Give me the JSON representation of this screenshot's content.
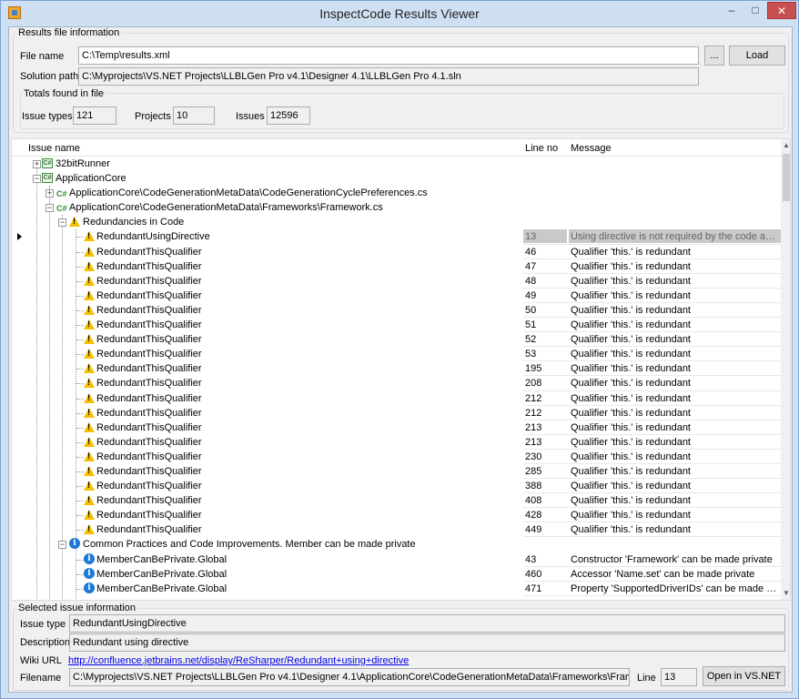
{
  "window": {
    "title": "InspectCode Results Viewer",
    "controls": {
      "min": "–",
      "max": "□",
      "close": "✕"
    }
  },
  "results_group": {
    "label": "Results file information",
    "file_name_label": "File name",
    "file_name_value": "C:\\Temp\\results.xml",
    "browse_label": "...",
    "load_label": "Load",
    "solution_path_label": "Solution path",
    "solution_path_value": "C:\\Myprojects\\VS.NET Projects\\LLBLGen Pro v4.1\\Designer 4.1\\LLBLGen Pro 4.1.sln"
  },
  "totals_group": {
    "label": "Totals found in file",
    "issue_types_label": "Issue types",
    "issue_types_value": "121",
    "projects_label": "Projects",
    "projects_value": "10",
    "issues_label": "Issues",
    "issues_value": "12596"
  },
  "grid": {
    "columns": {
      "name": "Issue name",
      "line": "Line no",
      "message": "Message"
    },
    "tree": {
      "project1": "32bitRunner",
      "project2": "ApplicationCore",
      "file1": "ApplicationCore\\CodeGenerationMetaData\\CodeGenerationCyclePreferences.cs",
      "file2": "ApplicationCore\\CodeGenerationMetaData\\Frameworks\\Framework.cs",
      "category1": "Redundancies in Code",
      "category2": "Common Practices and Code Improvements. Member can be made private"
    },
    "redundancy_rows": [
      {
        "name": "RedundantUsingDirective",
        "line": "13",
        "message": "Using directive is not required by the code and can b..."
      },
      {
        "name": "RedundantThisQualifier",
        "line": "46",
        "message": "Qualifier 'this.' is redundant"
      },
      {
        "name": "RedundantThisQualifier",
        "line": "47",
        "message": "Qualifier 'this.' is redundant"
      },
      {
        "name": "RedundantThisQualifier",
        "line": "48",
        "message": "Qualifier 'this.' is redundant"
      },
      {
        "name": "RedundantThisQualifier",
        "line": "49",
        "message": "Qualifier 'this.' is redundant"
      },
      {
        "name": "RedundantThisQualifier",
        "line": "50",
        "message": "Qualifier 'this.' is redundant"
      },
      {
        "name": "RedundantThisQualifier",
        "line": "51",
        "message": "Qualifier 'this.' is redundant"
      },
      {
        "name": "RedundantThisQualifier",
        "line": "52",
        "message": "Qualifier 'this.' is redundant"
      },
      {
        "name": "RedundantThisQualifier",
        "line": "53",
        "message": "Qualifier 'this.' is redundant"
      },
      {
        "name": "RedundantThisQualifier",
        "line": "195",
        "message": "Qualifier 'this.' is redundant"
      },
      {
        "name": "RedundantThisQualifier",
        "line": "208",
        "message": "Qualifier 'this.' is redundant"
      },
      {
        "name": "RedundantThisQualifier",
        "line": "212",
        "message": "Qualifier 'this.' is redundant"
      },
      {
        "name": "RedundantThisQualifier",
        "line": "212",
        "message": "Qualifier 'this.' is redundant"
      },
      {
        "name": "RedundantThisQualifier",
        "line": "213",
        "message": "Qualifier 'this.' is redundant"
      },
      {
        "name": "RedundantThisQualifier",
        "line": "213",
        "message": "Qualifier 'this.' is redundant"
      },
      {
        "name": "RedundantThisQualifier",
        "line": "230",
        "message": "Qualifier 'this.' is redundant"
      },
      {
        "name": "RedundantThisQualifier",
        "line": "285",
        "message": "Qualifier 'this.' is redundant"
      },
      {
        "name": "RedundantThisQualifier",
        "line": "388",
        "message": "Qualifier 'this.' is redundant"
      },
      {
        "name": "RedundantThisQualifier",
        "line": "408",
        "message": "Qualifier 'this.' is redundant"
      },
      {
        "name": "RedundantThisQualifier",
        "line": "428",
        "message": "Qualifier 'this.' is redundant"
      },
      {
        "name": "RedundantThisQualifier",
        "line": "449",
        "message": "Qualifier 'this.' is redundant"
      }
    ],
    "private_rows": [
      {
        "name": "MemberCanBePrivate.Global",
        "line": "43",
        "message": "Constructor 'Framework' can be made private"
      },
      {
        "name": "MemberCanBePrivate.Global",
        "line": "460",
        "message": "Accessor 'Name.set' can be made private"
      },
      {
        "name": "MemberCanBePrivate.Global",
        "line": "471",
        "message": "Property 'SupportedDriverIDs' can be made private"
      }
    ]
  },
  "selected": {
    "label": "Selected issue information",
    "issue_type_label": "Issue type",
    "issue_type_value": "RedundantUsingDirective",
    "description_label": "Description",
    "description_value": "Redundant using directive",
    "wiki_label": "Wiki URL",
    "wiki_value": "http://confluence.jetbrains.net/display/ReSharper/Redundant+using+directive",
    "filename_label": "Filename",
    "filename_value": "C:\\Myprojects\\VS.NET Projects\\LLBLGen Pro v4.1\\Designer 4.1\\ApplicationCore\\CodeGenerationMetaData\\Frameworks\\Framework.cs",
    "line_label": "Line",
    "line_value": "13",
    "open_label": "Open in VS.NET"
  },
  "colors": {
    "window_frame": "#cfe0f3",
    "close": "#c75050",
    "warning": "#f4c000",
    "info": "#1a78d6",
    "csharp": "#2e8b2e"
  }
}
